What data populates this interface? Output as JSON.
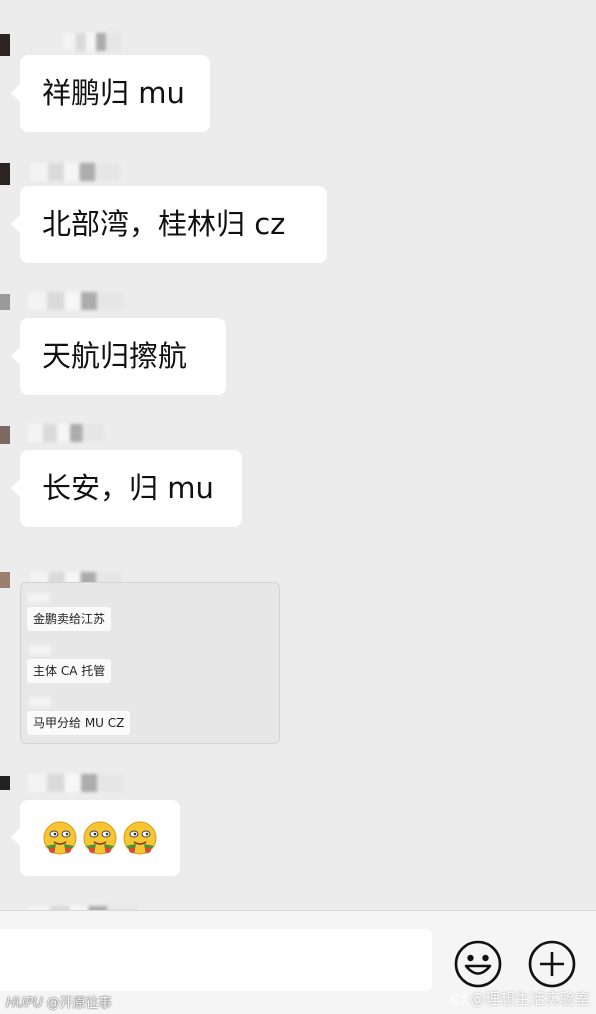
{
  "messages": [
    {
      "text": "祥鹏归 mu"
    },
    {
      "text": "北部湾，桂林归 cz"
    },
    {
      "text": "天航归擦航"
    },
    {
      "text": "长安，归 mu"
    }
  ],
  "card": {
    "notes": [
      {
        "text": "金鹏卖给江苏"
      },
      {
        "text": "主体 CA 托管"
      },
      {
        "text": "马甲分给 MU CZ"
      }
    ]
  },
  "emoji_message": {
    "emoji_icon": "smiling-face-with-flowers-icon",
    "count": 3
  },
  "input": {
    "emoji_button_icon": "smiley-face-icon",
    "plus_button_icon": "plus-circle-icon"
  },
  "watermarks": {
    "left_brand": "HUPU",
    "left_text": "@开原往事",
    "right_text": "@理想生活实验室",
    "right_icon": "weibo-icon"
  },
  "colors": {
    "chat_background": "#ececec",
    "bubble": "#ffffff",
    "input_bar": "#f5f5f5",
    "emoji_face": "#f6c632"
  }
}
